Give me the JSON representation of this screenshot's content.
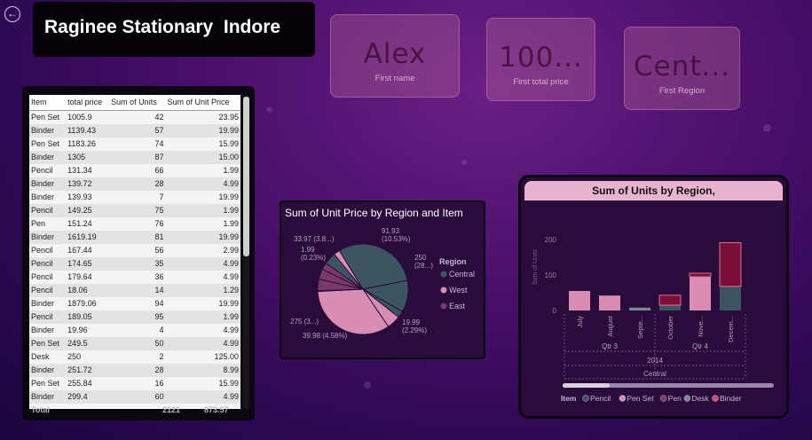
{
  "header": {
    "title": "Raginee Stationary  Indore",
    "back_icon": "back-arrow-icon"
  },
  "cards": [
    {
      "value": "Alex",
      "label": "First name"
    },
    {
      "value": "100...",
      "label": "First  total price"
    },
    {
      "value": "Cent...",
      "label": "First Region"
    }
  ],
  "table": {
    "columns": [
      "Item",
      "total price",
      "Sum of Units",
      "Sum of Unit Price"
    ],
    "rows": [
      [
        "Pen Set",
        "1005.9",
        "42",
        "23.95"
      ],
      [
        "Binder",
        "1139.43",
        "57",
        "19.99"
      ],
      [
        "Pen Set",
        "1183.26",
        "74",
        "15.99"
      ],
      [
        "Binder",
        "1305",
        "87",
        "15.00"
      ],
      [
        "Pencil",
        "131.34",
        "66",
        "1.99"
      ],
      [
        "Binder",
        "139.72",
        "28",
        "4.99"
      ],
      [
        "Binder",
        "139.93",
        "7",
        "19.99"
      ],
      [
        "Pencil",
        "149.25",
        "75",
        "1.99"
      ],
      [
        "Pen",
        "151.24",
        "76",
        "1.99"
      ],
      [
        "Binder",
        "1619.19",
        "81",
        "19.99"
      ],
      [
        "Pencil",
        "167.44",
        "56",
        "2.99"
      ],
      [
        "Pencil",
        "174.65",
        "35",
        "4.99"
      ],
      [
        "Pencil",
        "179.64",
        "36",
        "4.99"
      ],
      [
        "Pencil",
        "18.06",
        "14",
        "1.29"
      ],
      [
        "Binder",
        "1879.06",
        "94",
        "19.99"
      ],
      [
        "Pencil",
        "189.05",
        "95",
        "1.99"
      ],
      [
        "Binder",
        "19.96",
        "4",
        "4.99"
      ],
      [
        "Pen Set",
        "249.5",
        "50",
        "4.99"
      ],
      [
        "Desk",
        "250",
        "2",
        "125.00"
      ],
      [
        "Binder",
        "251.72",
        "28",
        "8.99"
      ],
      [
        "Pen Set",
        "255.84",
        "16",
        "15.99"
      ],
      [
        "Binder",
        "299.4",
        "60",
        "4.99"
      ]
    ],
    "total": [
      "Total",
      "",
      "2121",
      "873.57"
    ]
  },
  "colors": {
    "central": "#3d5560",
    "west": "#d98db3",
    "east": "#7a3a6a",
    "binder": "#7a0f38",
    "desk": "#3d5560"
  },
  "chart_data": [
    {
      "type": "pie",
      "title": "Sum of Unit Price by Region and Item",
      "legend_title": "Region",
      "legend": [
        "Central",
        "West",
        "East"
      ],
      "slices": [
        {
          "region": "Central",
          "value": 250,
          "label": "250 (28...)"
        },
        {
          "region": "Central",
          "value": 91.93,
          "label": "91.93 (10.53%)"
        },
        {
          "region": "Central",
          "value": 19.99,
          "label": "19.99 (2.29%)"
        },
        {
          "region": "West",
          "value": 39.98,
          "label": "39.98 (4.58%)"
        },
        {
          "region": "West",
          "value": 275,
          "label": "275 (3...)"
        },
        {
          "region": "East",
          "value": 1.99,
          "label": "1.99 (0.23%)"
        },
        {
          "region": "East",
          "value": 33.97,
          "label": "33.97 (3.8...)"
        },
        {
          "region": "East",
          "value": 30,
          "label": ""
        },
        {
          "region": "East",
          "value": 20,
          "label": ""
        },
        {
          "region": "Central",
          "value": 35,
          "label": ""
        },
        {
          "region": "West",
          "value": 18,
          "label": ""
        }
      ]
    },
    {
      "type": "bar",
      "title": "Sum of Units by Region,",
      "ylabel": "Sum of Units",
      "ylim": [
        0,
        250
      ],
      "yticks": [
        0,
        100,
        200
      ],
      "categories": [
        "July",
        "August",
        "Septe...",
        "October",
        "Nove...",
        "Decem..."
      ],
      "hierarchy": {
        "quarters": [
          {
            "label": "Qtr 3",
            "span": 3
          },
          {
            "label": "Qtr 4",
            "span": 3
          }
        ],
        "year": "2014",
        "region": "Central"
      },
      "series": [
        {
          "name": "Pencil",
          "values": [
            0,
            0,
            0,
            0,
            0,
            0
          ]
        },
        {
          "name": "Pen Set",
          "values": [
            55,
            42,
            0,
            0,
            95,
            0
          ]
        },
        {
          "name": "Pen",
          "values": [
            0,
            0,
            8,
            0,
            0,
            0
          ]
        },
        {
          "name": "Desk",
          "values": [
            0,
            0,
            0,
            15,
            0,
            68
          ]
        },
        {
          "name": "Binder",
          "values": [
            0,
            0,
            0,
            28,
            10,
            123
          ]
        }
      ],
      "legend_title": "Item",
      "legend": [
        "Pencil",
        "Pen Set",
        "Pen",
        "Desk",
        "Binder"
      ],
      "legend_colors": [
        "#3d5560",
        "#d98db3",
        "#7a3a6a",
        "#7a8a90",
        "#d24a6a"
      ]
    }
  ]
}
